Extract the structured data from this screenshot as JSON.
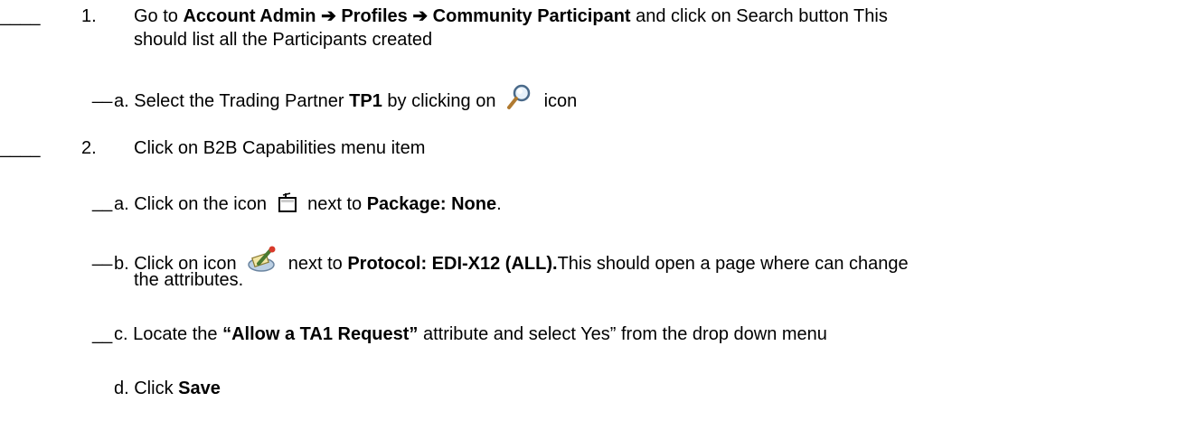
{
  "step1": {
    "blank": "____",
    "number": "1.",
    "text_prefix": "Go to ",
    "path": [
      "Account Admin",
      "Profiles",
      "Community Participant"
    ],
    "arrow": "➔",
    "text_suffix": " and click on Search button This",
    "text_line2": "should list all the Participants created"
  },
  "step1a": {
    "blank": "__",
    "prefix": "a. Select the Trading Partner ",
    "bold": "TP1",
    "middle": " by clicking on ",
    "icon": "magnifier-icon",
    "suffix": " icon"
  },
  "step2": {
    "blank": "____",
    "number": "2.",
    "text": "Click on B2B Capabilities menu item"
  },
  "step2a": {
    "blank": "__",
    "prefix": "a. Click on the icon ",
    "icon": "folder-icon",
    "middle": " next to ",
    "bold": "Package: None",
    "suffix": "."
  },
  "step2b": {
    "blank": "__",
    "prefix": "b. Click on icon ",
    "icon": "edit-attributes-icon",
    "middle": " next to ",
    "bold": "Protocol: EDI-X12 (ALL).",
    "suffix": "This should open a page where can change",
    "line2": "the attributes."
  },
  "step2c": {
    "blank": "__",
    "prefix": "c. Locate the ",
    "bold": "“Allow a TA1 Request”",
    "suffix": " attribute and select  Yes” from the drop down menu"
  },
  "step2d": {
    "prefix": "d. Click ",
    "bold": "Save"
  }
}
